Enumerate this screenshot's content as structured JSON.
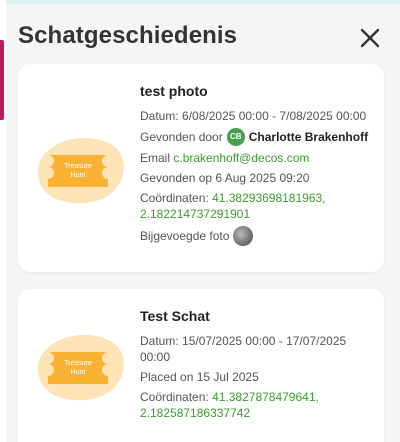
{
  "dialog": {
    "title": "Schatgeschiedenis"
  },
  "icons": {
    "close": "close-icon",
    "thumb": "treasure-ticket-icon"
  },
  "colors": {
    "link_green": "#3a9c2c",
    "avatar_green": "#43a047",
    "ticket_orange": "#f9b233",
    "ticket_blob": "#fde3b5"
  },
  "treasures": [
    {
      "name": "test photo",
      "thumb_text": "Treasure Hunt",
      "date_label": "Datum:",
      "date_value": "6/08/2025 00:00 - 7/08/2025 00:00",
      "found_by_label": "Gevonden door",
      "finder_initials": "CB",
      "finder_name": "Charlotte Brakenhoff",
      "email_label": "Email",
      "email_value": "c.brakenhoff@decos.com",
      "found_on": "Gevonden op 6 Aug 2025 09:20",
      "coords_label": "Coördinaten:",
      "lat": "41.38293698181963,",
      "lon": "2.182214737291901",
      "photo_label": "Bijgevoegde foto"
    },
    {
      "name": "Test Schat",
      "thumb_text": "Treasure Hunt",
      "date_label": "Datum:",
      "date_value": "15/07/2025 00:00 - 17/07/2025 00:00",
      "placed_on": "Placed on 15 Jul 2025",
      "coords_label": "Coördinaten:",
      "lat": "41.3827878479641,",
      "lon": "2.182587186337742"
    }
  ]
}
